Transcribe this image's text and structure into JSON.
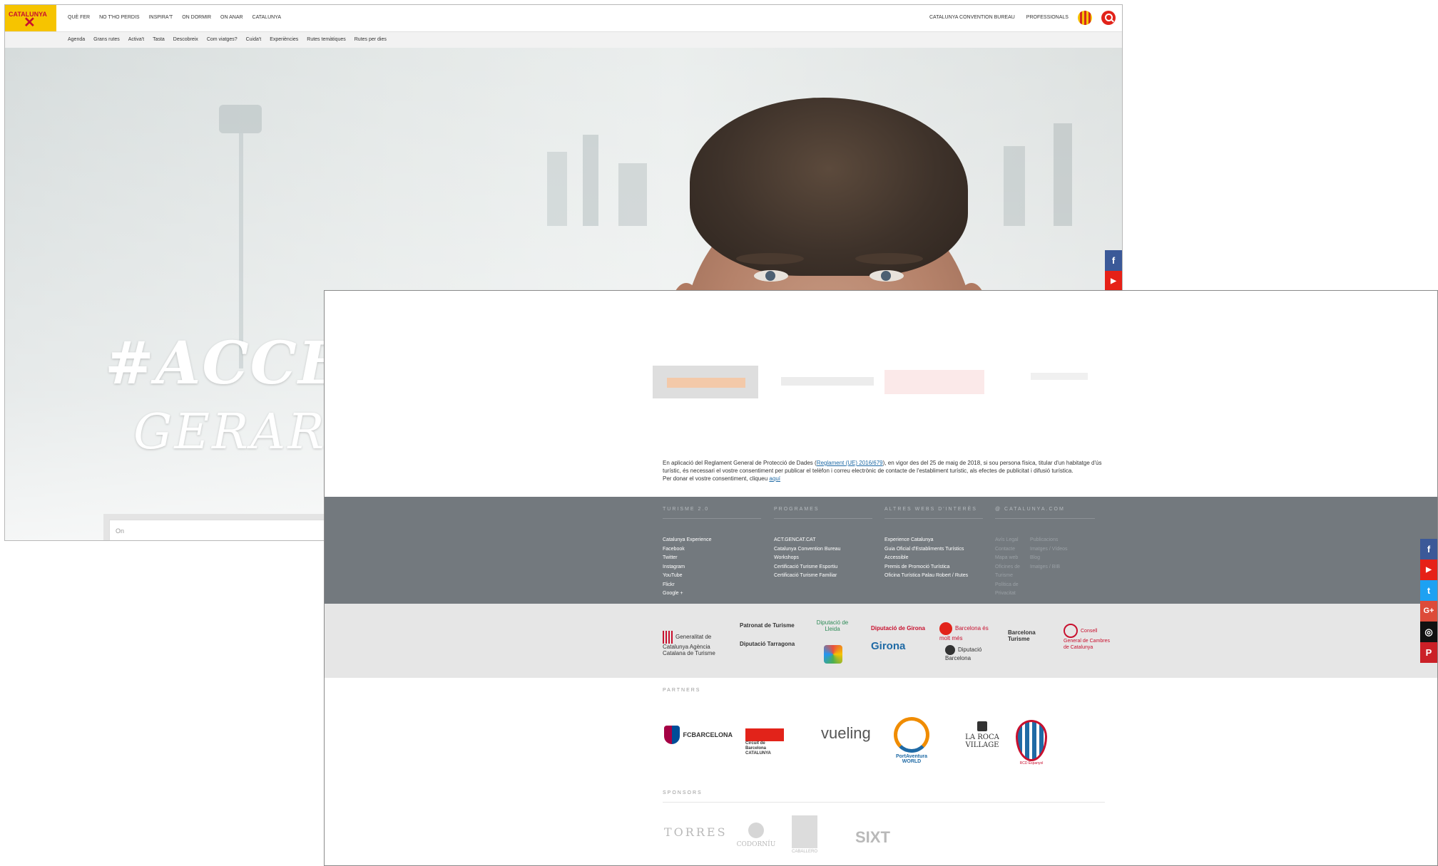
{
  "shotA": {
    "logo": {
      "text": "CATALUNYA",
      "mark": "✕"
    },
    "main_nav": [
      "QUÈ FER",
      "NO T'HO PERDIS",
      "INSPIRA'T",
      "ON DORMIR",
      "ON ANAR",
      "CATALUNYA"
    ],
    "right_nav": [
      "CATALUNYA CONVENTION BUREAU",
      "PROFESSIONALS"
    ],
    "sub_nav": [
      "Agenda",
      "Grans rutes",
      "Activa't",
      "Tasta",
      "Descobreix",
      "Com viatges?",
      "Cuida't",
      "Experiències",
      "Rutes temàtiques",
      "Rutes per dies"
    ],
    "hero_tagline": "#ACCEPTE",
    "hero_name": "GERARD PIQU",
    "search_placeholder": "On",
    "social": [
      "f",
      "▶"
    ],
    "colors": {
      "brand_yellow": "#f6c400",
      "brand_red": "#e2231a",
      "facebook": "#3b5998",
      "youtube": "#e62117"
    }
  },
  "shotB": {
    "gdpr": {
      "before_link": "En aplicació del Reglament General de Protecció de Dades (",
      "link": "Reglament (UE) 2016/679",
      "after_link": "), en vigor des del 25 de maig de 2018, si sou persona física, titular d'un habitatge d'ús turístic, és necessari el vostre consentiment per publicar el telèfon i correu electrònic de contacte de l'establiment turístic, als efectes de publicitat i difusió turística.",
      "line2_before": "Per donar el vostre consentiment, cliqueu ",
      "line2_link": "aquí"
    },
    "footer": {
      "col1": {
        "heading": "TURISME 2.0",
        "items": [
          "Catalunya Experience",
          "Facebook",
          "Twitter",
          "Instagram",
          "YouTube",
          "Flickr",
          "Google +"
        ]
      },
      "col2": {
        "heading": "PROGRAMES",
        "items": [
          "ACT.GENCAT.CAT",
          "Catalunya Convention Bureau",
          "Workshops",
          "Certificació Turisme Esportiu",
          "Certificació Turisme Familiar"
        ]
      },
      "col3": {
        "heading": "ALTRES WEBS D'INTERÈS",
        "items": [
          "Experience Catalunya",
          "Guia Oficial d'Establiments Turístics",
          "Accessible",
          "Premis de Promoció Turística",
          "Oficina Turística Palau Robert / Rutes"
        ]
      },
      "col4": {
        "heading": "@ CATALUNYA.COM",
        "left": [
          "Avís Legal",
          "Contacte",
          "Mapa web",
          "Oficines de",
          "Turisme",
          "Política de",
          "Privacitat"
        ],
        "right": [
          "Publicacions",
          "Imatges / Vídeos",
          "Blog",
          "Imatges / BIB"
        ]
      }
    },
    "institutions": [
      "Generalitat de Catalunya Agència Catalana de Turisme",
      "Patronat de Turisme",
      "Diputació Tarragona",
      "Diputació de Lleida",
      "Diputació de Girona",
      "Girona",
      "Barcelona és molt més",
      "Diputació Barcelona",
      "Barcelona Turisme",
      "Consell General de Cambres de Catalunya"
    ],
    "partners_heading": "PARTNERS",
    "partners": [
      "FCBARCELONA",
      "Circuit de Barcelona CATALUNYA",
      "vueling",
      "PortAventura WORLD",
      "LA ROCA VILLAGE",
      "RCD Espanyol"
    ],
    "sponsors_heading": "SPONSORS",
    "sponsors": [
      "TORRES",
      "CODORNÍU",
      "CABALLERO",
      "SIXT"
    ],
    "social": [
      "f",
      "▶",
      "t",
      "G+",
      "◎",
      "P"
    ]
  }
}
